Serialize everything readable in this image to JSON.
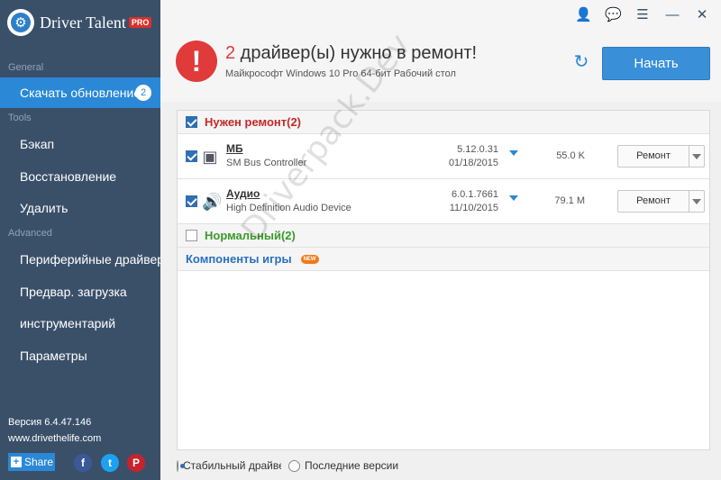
{
  "app": {
    "name": "Driver Talent",
    "edition": "PRO",
    "version": "Версия 6.4.47.146",
    "website": "www.drivethelife.com"
  },
  "sidebar": {
    "sections": {
      "general": "General",
      "tools": "Tools",
      "advanced": "Advanced"
    },
    "items": [
      {
        "label": "Скачать обновление",
        "badge": "2",
        "active": true
      },
      {
        "label": "Бэкап"
      },
      {
        "label": "Восстановление"
      },
      {
        "label": "Удалить"
      },
      {
        "label": "Периферийные драйверы"
      },
      {
        "label": "Предвар. загрузка"
      },
      {
        "label": "инструментарий"
      },
      {
        "label": "Параметры"
      }
    ],
    "share_label": "Share"
  },
  "header": {
    "count": "2",
    "title_rest": " драйвер(ы) нужно в ремонт!",
    "subtitle": "Майкрософт Windows 10 Pro 64-бит Рабочий стол",
    "start_button": "Начать"
  },
  "groups": {
    "repair": "Нужен ремонт(2)",
    "normal": "Нормальный(2)",
    "games": "Компоненты игры",
    "new_badge": "NEW"
  },
  "drivers": [
    {
      "name": "МБ",
      "description": "SM Bus Controller",
      "version": "5.12.0.31",
      "date": "01/18/2015",
      "size": "55.0 K",
      "action": "Ремонт",
      "icon": "chip-icon"
    },
    {
      "name": "Аудио",
      "description": "High Definition Audio Device",
      "version": "6.0.1.7661",
      "date": "11/10/2015",
      "size": "79.1 M",
      "action": "Ремонт",
      "icon": "speaker-icon"
    }
  ],
  "footer": {
    "stable_option": "Стабильный драйвер",
    "latest_option": "Последние версии"
  },
  "watermark": "Driverpack.Dev",
  "colors": {
    "sidebar_bg": "#3a5069",
    "accent": "#2a88d6",
    "alert_red": "#e13a3a",
    "normal_green": "#3a9a2a"
  }
}
